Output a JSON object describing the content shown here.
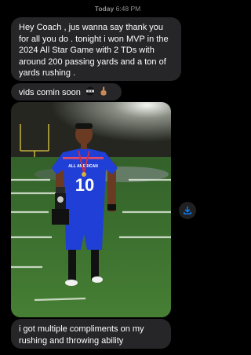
{
  "header": {
    "day": "Today",
    "time": "6:48 PM"
  },
  "messages": [
    {
      "text": "Hey Coach , jus wanna say thank you for all you do . tonight i won MVP in the 2024 All Star Game with 2 TDs with around 200 passing yards and a ton of yards rushing ."
    },
    {
      "text": "vids comin soon",
      "emojis": [
        "ninja-emoji",
        "index-pointing-emoji"
      ]
    },
    {
      "text": "i got multiple compliments on my rushing and throwing ability"
    }
  ],
  "photo": {
    "jersey_number": "10",
    "jersey_text": "ALL AMERICAN"
  },
  "colors": {
    "bubble": "#262629",
    "accent": "#0a84ff",
    "jersey": "#1f3fd6",
    "field": "#3f7a2e"
  }
}
